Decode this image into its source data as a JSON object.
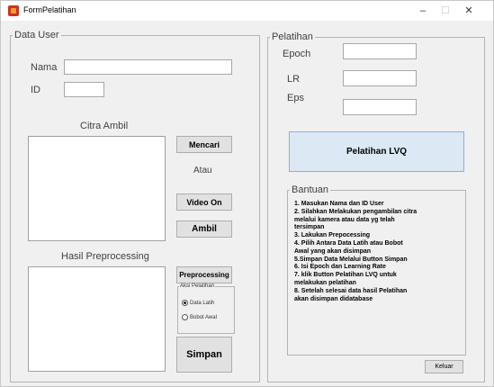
{
  "window": {
    "title": "FormPelatihan",
    "min_glyph": "–",
    "max_glyph": "☐",
    "close_glyph": "✕"
  },
  "data_user": {
    "legend": "Data User",
    "nama_label": "Nama",
    "nama_value": "",
    "id_label": "ID",
    "id_value": "",
    "citra_label": "Citra Ambil",
    "mencari_button": "Mencari",
    "atau_label": "Atau",
    "video_on_button": "Video On",
    "ambil_button": "Ambil",
    "hasil_label": "Hasil Preprocessing",
    "preprocessing_button": "Preprocessing",
    "aksi": {
      "legend": "Aksi Pelatihan",
      "options": [
        {
          "label": "Data Latih",
          "checked": true
        },
        {
          "label": "Bobot Awal",
          "checked": false
        }
      ]
    },
    "simpan_button": "Simpan"
  },
  "pelatihan": {
    "legend": "Pelatihan",
    "epoch_label": "Epoch",
    "epoch_value": "",
    "lr_label": "LR",
    "lr_value": "",
    "eps_label": "Eps",
    "eps_value": "",
    "lvq_button": "Pelatihan LVQ",
    "bantuan": {
      "legend": "Bantuan",
      "lines": [
        "1. Masukan Nama dan ID User",
        "2. Silahkan Melakukan pengambilan citra",
        "melalui kamera atau data yg telah",
        "tersimpan",
        "3. Lakukan Prepocessing",
        "4. Pilih Antara Data Latih atau Bobot",
        "Awal yang akan disimpan",
        "5.Simpan Data Melalui Button Simpan",
        "6. Isi Epoch dan Learning Rate",
        "7. klik Button Pelatihan LVQ untuk",
        "melakukan pelatihan",
        "8. Setelah selesai data hasil Pelatihan",
        "akan disimpan didatabase"
      ]
    },
    "keluar_button": "Keluar"
  }
}
